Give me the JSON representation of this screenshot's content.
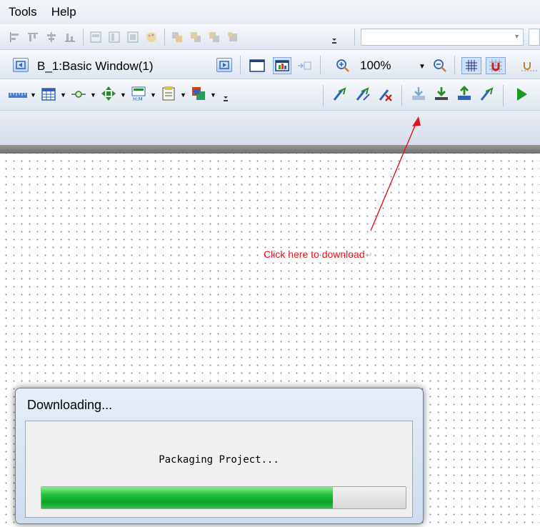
{
  "menu": {
    "items": [
      "Tools",
      "Help"
    ]
  },
  "toolbar_window": {
    "selected_window": "B_1:Basic Window(1)",
    "zoom": "100%"
  },
  "annotation": {
    "text": "Click here to download",
    "mark": "↵",
    "color": "#e4141b"
  },
  "dialog": {
    "title": "Downloading...",
    "status": "Packaging Project...",
    "progress": 0.8
  },
  "icons": {
    "align-left": "align-left-icon",
    "align-top": "align-top-icon",
    "center": "center-icon",
    "distribute": "distribute-icon",
    "window-prev": "window-prev-icon",
    "window-next": "window-next-icon",
    "zoom-in": "zoom-in-icon",
    "zoom-out": "zoom-out-icon",
    "grid": "grid-icon",
    "snap": "snap-icon",
    "compile": "compile-icon",
    "download": "download-icon",
    "upload": "upload-icon",
    "run": "run-icon"
  },
  "colors": {
    "accent": "#2f62b8",
    "progress_green": "#0ba226",
    "run_green": "#1a9a1a"
  }
}
